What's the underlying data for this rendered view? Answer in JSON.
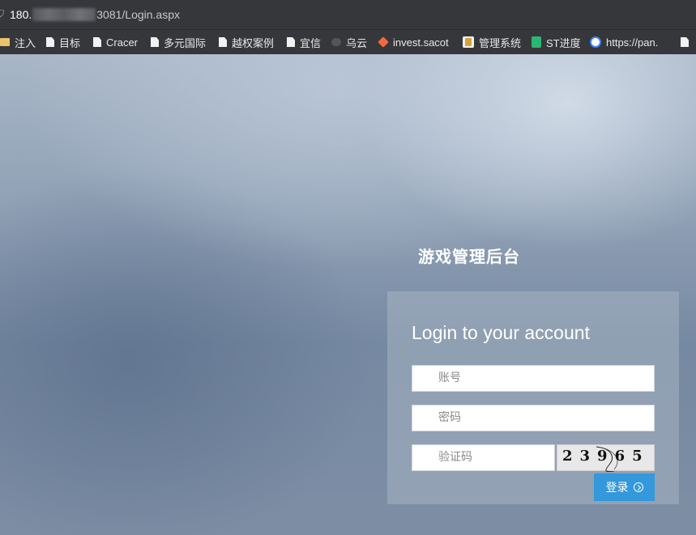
{
  "browser": {
    "url_host": "180.",
    "url_rest": "3081/Login.aspx"
  },
  "bookmarks": [
    {
      "label": "注入",
      "icon": "folder-icon"
    },
    {
      "label": "目标",
      "icon": "page-icon"
    },
    {
      "label": "Cracer",
      "icon": "page-icon"
    },
    {
      "label": "多元国际",
      "icon": "page-icon"
    },
    {
      "label": "越权案例",
      "icon": "page-icon"
    },
    {
      "label": "宜信",
      "icon": "page-icon"
    },
    {
      "label": "乌云",
      "icon": "cloud-icon"
    },
    {
      "label": "invest.sacot",
      "icon": "sacot-icon"
    },
    {
      "label": "管理系统",
      "icon": "app-icon"
    },
    {
      "label": "ST进度",
      "icon": "sheet-icon"
    },
    {
      "label": "https://pan.",
      "icon": "baidu-pan-icon"
    }
  ],
  "login": {
    "site_title": "游戏管理后台",
    "heading": "Login to your account",
    "username_placeholder": "账号",
    "password_placeholder": "密码",
    "captcha_placeholder": "验证码",
    "captcha_text": "23965",
    "submit_label": "登录"
  }
}
